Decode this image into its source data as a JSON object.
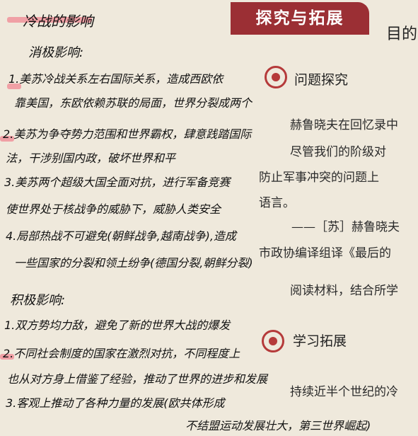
{
  "banner": "探究与拓展",
  "top_right": "目的",
  "section1": {
    "title": "问题探究"
  },
  "section2": {
    "title": "学习拓展"
  },
  "printed": [
    "赫鲁晓夫在回忆录中",
    "尽管我们的阶级对",
    "防止军事冲突的问题上",
    "语言。",
    "——［苏］赫鲁晓夫",
    "市政协编译组译《最后的",
    "阅读材料，结合所学",
    "持续近半个世纪的冷"
  ],
  "notes": {
    "title": "冷战的影响",
    "neg_header": "消极影响:",
    "lines": [
      "1.美苏冷战关系左右国际关系，造成西欧依",
      "靠美国，东欧依赖苏联的局面，世界分裂成两个",
      "2.美苏为争夺势力范围和世界霸权，肆意践踏国际",
      "法，干涉别国内政，破坏世界和平",
      "3.美苏两个超级大国全面对抗，进行军备竞赛",
      "使世界处于核战争的威胁下，威胁人类安全",
      "4.局部热战不可避免(朝鲜战争,越南战争),造成",
      "一些国家的分裂和领土纷争(德国分裂,朝鲜分裂)"
    ],
    "pos_header": "积极影响:",
    "pos_lines": [
      "1.双方势均力敌，避免了新的世界大战的爆发",
      "2.不同社会制度的国家在激烈对抗，不同程度上",
      "也从对方身上借鉴了经验，推动了世界的进步和发展",
      "3.客观上推动了各种力量的发展(欧共体形成",
      "不结盟运动发展壮大，第三世界崛起)"
    ]
  }
}
